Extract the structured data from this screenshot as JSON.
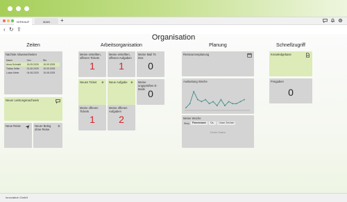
{
  "window": {
    "tabs": [
      {
        "label": "VERKAUF",
        "active": true
      },
      {
        "label": "MAIN",
        "active": false
      }
    ],
    "add_tab": "+",
    "toolbar_icons": [
      "chat-icon",
      "bell-icon",
      "gear-icon"
    ],
    "nav": {
      "back": "‹",
      "refresh": "↻",
      "share": "⇪"
    }
  },
  "page": {
    "title": "Organisation",
    "columns": [
      "Zeiten",
      "Arbeitsorganisation",
      "Planung",
      "Schnellzugriff"
    ]
  },
  "zeiten": {
    "absence": {
      "title": "Nächste Abwesenheiten",
      "headers": [
        "Name",
        "Von",
        "Bis"
      ],
      "rows": [
        {
          "name": "Anna Schmidt",
          "from": "15.09.2025",
          "to": "15.09.2025",
          "highlight": true
        },
        {
          "name": "Tobias Keller",
          "from": "01.06.2025",
          "to": "15.09.2025",
          "highlight": false
        },
        {
          "name": "Lukas Meier",
          "from": "04.08.2025",
          "to": "15.08.2025",
          "highlight": false
        }
      ]
    },
    "leistungsnachweis": {
      "label": "Neuer Leistungsnachweis",
      "icon": "chat-icon"
    },
    "reise": {
      "label": "Neue Reise",
      "icon": "plane-icon"
    },
    "beleg": {
      "label": "Neuer Beleg ohne Reise",
      "icon": "plus-icon"
    }
  },
  "arbeitsorganisation": {
    "tiles": [
      {
        "label": "Meine erstellten, offenen Tickets",
        "value": "1",
        "color": "red"
      },
      {
        "label": "Meine erstellten, offenen Aufgaben",
        "value": "1",
        "color": "red"
      },
      {
        "label": "Meine Mail To Dos",
        "value": "0",
        "color": "dark"
      },
      {
        "label": "Neues Ticket",
        "icon": "plus-icon"
      },
      {
        "label": "Neue Aufgabe",
        "icon": "plus-icon"
      },
      {
        "label": "Meine ungeprüften E-Mails",
        "value": "0",
        "color": "dark"
      },
      {
        "label": "Meine offenen Tickets",
        "value": "1",
        "color": "red"
      },
      {
        "label": "Meine offenen Aufgaben",
        "value": "2",
        "color": "red"
      }
    ]
  },
  "planung": {
    "ressourcen": {
      "label": "Ressourcenplanung",
      "icon": "calendar-icon"
    },
    "auslastung": {
      "label": "Auslastung Woche"
    },
    "woche": {
      "label": "Meine Woche",
      "fields": [
        "Story",
        "Firmenname",
        "Da..",
        "Unser Zeichen"
      ],
      "empty": "Keine Daten"
    }
  },
  "schnellzugriff": {
    "knowledgebase": {
      "label": "Knowledgebase",
      "icon": "document-icon"
    },
    "freigaben": {
      "label": "Freigaben",
      "value": "0"
    }
  },
  "chart_data": {
    "type": "line",
    "title": "",
    "x": [
      1,
      2,
      3,
      4,
      5,
      6,
      7,
      8,
      9,
      10,
      11,
      12,
      13,
      14,
      15,
      16
    ],
    "series": [
      {
        "values": [
          1,
          3,
          9,
          5,
          4,
          5,
          3,
          4,
          2,
          5,
          2,
          4,
          3,
          3,
          4,
          5
        ]
      }
    ],
    "ylim": [
      0,
      10
    ],
    "color": "#3f8c87"
  },
  "footer": {
    "company": "Innovatech GmbH"
  },
  "colors": {
    "accent_green": "#a5cf59",
    "tile_green": "#dcebb8",
    "tile_gray": "#d4d4d4",
    "alert_red": "#d4212a"
  }
}
